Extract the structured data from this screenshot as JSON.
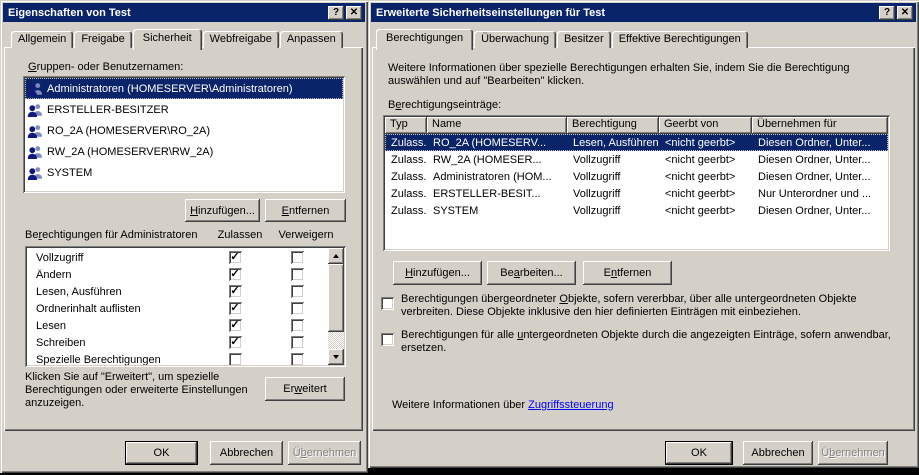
{
  "icons": {
    "checkmark": "✓"
  },
  "colors": {
    "titlebar": "#0a246a",
    "dialog_face": "#d4d0c8",
    "selection": "#0a246a",
    "link": "#0000ff"
  },
  "left_dialog": {
    "title": "Eigenschaften von Test",
    "titlebar": {
      "help_glyph": "?",
      "close_glyph": "✕"
    },
    "tabs": [
      {
        "label": "Allgemein",
        "active": false
      },
      {
        "label": "Freigabe",
        "active": false
      },
      {
        "label": "Sicherheit",
        "active": true
      },
      {
        "label": "Webfreigabe",
        "active": false
      },
      {
        "label": "Anpassen",
        "active": false
      }
    ],
    "group_label": {
      "text": "Gruppen- oder Benutzernamen:",
      "u": 0
    },
    "users": [
      {
        "name": "Administratoren (HOMESERVER\\Administratoren)",
        "selected": true
      },
      {
        "name": "ERSTELLER-BESITZER",
        "selected": false
      },
      {
        "name": "RO_2A (HOMESERVER\\RO_2A)",
        "selected": false
      },
      {
        "name": "RW_2A (HOMESERVER\\RW_2A)",
        "selected": false
      },
      {
        "name": "SYSTEM",
        "selected": false
      }
    ],
    "add_button": {
      "text": "Hinzufügen...",
      "u": 0
    },
    "remove_button": {
      "text": "Entfernen",
      "u": 0
    },
    "permissions_label": {
      "text": "Berechtigungen für Administratoren",
      "u": 2
    },
    "allow_header": "Zulassen",
    "deny_header": "Verweigern",
    "permissions": [
      {
        "label": "Vollzugriff",
        "allow": true,
        "deny": false
      },
      {
        "label": "Ändern",
        "allow": true,
        "deny": false
      },
      {
        "label": "Lesen, Ausführen",
        "allow": true,
        "deny": false
      },
      {
        "label": "Ordnerinhalt auflisten",
        "allow": true,
        "deny": false
      },
      {
        "label": "Lesen",
        "allow": true,
        "deny": false
      },
      {
        "label": "Schreiben",
        "allow": true,
        "deny": false
      },
      {
        "label": "Spezielle Berechtigungen",
        "allow": false,
        "deny": false
      }
    ],
    "advanced_note": "Klicken Sie auf \"Erweitert\", um spezielle Berechtigungen oder erweiterte Einstellungen anzuzeigen.",
    "advanced_button": {
      "text": "Erweitert",
      "u": 2
    },
    "ok_button": "OK",
    "cancel_button": "Abbrechen",
    "apply_button": {
      "text": "Übernehmen",
      "u": 1
    }
  },
  "right_dialog": {
    "title": "Erweiterte Sicherheitseinstellungen für Test",
    "titlebar": {
      "help_glyph": "?",
      "close_glyph": "✕"
    },
    "tabs": [
      {
        "label": "Berechtigungen",
        "active": true
      },
      {
        "label": "Überwachung",
        "active": false
      },
      {
        "label": "Besitzer",
        "active": false
      },
      {
        "label": "Effektive Berechtigungen",
        "active": false
      }
    ],
    "info_text": "Weitere Informationen über spezielle Berechtigungen erhalten Sie, indem Sie die Berechtigung auswählen und auf \"Bearbeiten\" klicken.",
    "entries_label": {
      "text": "Berechtigungseinträge:",
      "u": 1
    },
    "table": {
      "columns": [
        "Typ",
        "Name",
        "Berechtigung",
        "Geerbt von",
        "Übernehmen für"
      ],
      "rows": [
        {
          "cells": [
            "Zulass...",
            "RO_2A (HOMESERV...",
            "Lesen, Ausführen",
            "<nicht geerbt>",
            "Diesen Ordner, Unter..."
          ],
          "selected": true
        },
        {
          "cells": [
            "Zulass...",
            "RW_2A (HOMESER...",
            "Vollzugriff",
            "<nicht geerbt>",
            "Diesen Ordner, Unter..."
          ],
          "selected": false
        },
        {
          "cells": [
            "Zulass...",
            "Administratoren (HOM...",
            "Vollzugriff",
            "<nicht geerbt>",
            "Diesen Ordner, Unter..."
          ],
          "selected": false
        },
        {
          "cells": [
            "Zulass...",
            "ERSTELLER-BESIT...",
            "Vollzugriff",
            "<nicht geerbt>",
            "Nur Unterordner und ..."
          ],
          "selected": false
        },
        {
          "cells": [
            "Zulass...",
            "SYSTEM",
            "Vollzugriff",
            "<nicht geerbt>",
            "Diesen Ordner, Unter..."
          ],
          "selected": false
        }
      ]
    },
    "add_button": {
      "text": "Hinzufügen...",
      "u": 0
    },
    "edit_button": {
      "text": "Bearbeiten...",
      "u": 2
    },
    "remove_button": {
      "text": "Entfernen",
      "u": 1
    },
    "inherit_checkbox": {
      "text": "Berechtigungen übergeordneter Objekte, sofern vererbbar, über alle untergeordneten Objekte verbreiten. Diese Objekte inklusive den hier definierten Einträgen mit einbeziehen.",
      "u": 30,
      "checked": false
    },
    "replace_checkbox": {
      "text": "Berechtigungen für alle untergeordneten Objekte durch die angezeigten Einträge, sofern anwendbar, ersetzen.",
      "u": 24,
      "checked": false
    },
    "footer_text": "Weitere Informationen über ",
    "footer_link": "Zugriffssteuerung",
    "ok_button": "OK",
    "cancel_button": "Abbrechen",
    "apply_button": {
      "text": "Übernehmen",
      "u": 1
    }
  }
}
